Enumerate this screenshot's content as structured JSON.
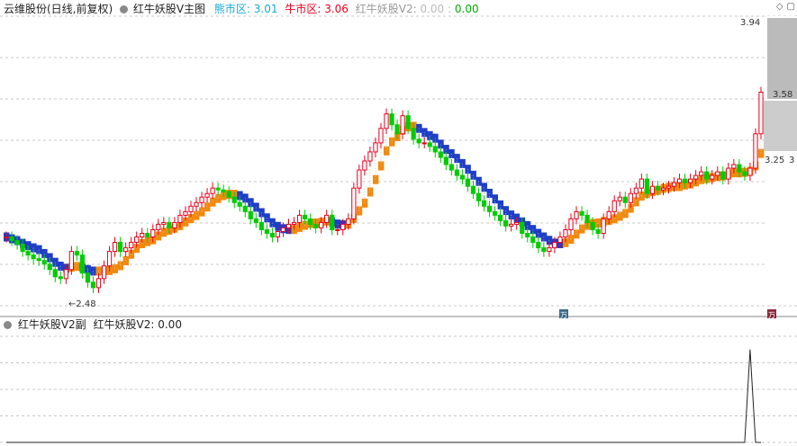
{
  "main_panel": {
    "stock_title": "云维股份(日线,前复权)",
    "indicator_name": "红牛妖股V主图",
    "bear_label": "熊市区:",
    "bear_value": "3.01",
    "bull_label": "牛市区:",
    "bull_value": "3.06",
    "v2_label": "红牛妖股V2:",
    "v2_value_a": "0.00",
    "v2_value_b": "0.00",
    "price_high": "3.94",
    "price_mid": "3.58",
    "price_low_right": "3.25",
    "price_min": "2.48",
    "right_tick_3": "3",
    "badge_blue": "万",
    "badge_red": "万"
  },
  "sub_panel": {
    "indicator_name": "红牛妖股V2副",
    "v2_label": "红牛妖股V2:",
    "v2_value": "0.00"
  },
  "colors": {
    "up": "#e8001c",
    "down": "#00cc00",
    "bear_band": "#1f3ec8",
    "bull_band": "#f08a10",
    "bear_text": "#18a8d8",
    "bull_text": "#e8001c",
    "grid": "#c8c8c8"
  },
  "chart_data": {
    "type": "candlestick",
    "x": [
      1,
      2,
      3,
      4,
      5,
      6,
      7,
      8,
      9,
      10,
      11,
      12,
      13,
      14,
      15,
      16,
      17,
      18,
      19,
      20,
      21,
      22,
      23,
      24,
      25,
      26,
      27,
      28,
      29,
      30,
      31,
      32,
      33,
      34,
      35,
      36,
      37,
      38,
      39,
      40,
      41,
      42,
      43,
      44,
      45,
      46,
      47,
      48,
      49,
      50,
      51,
      52,
      53,
      54,
      55,
      56,
      57,
      58,
      59,
      60,
      61,
      62,
      63,
      64,
      65,
      66,
      67,
      68,
      69,
      70,
      71,
      72,
      73,
      74,
      75,
      76,
      77,
      78,
      79,
      80,
      81,
      82,
      83,
      84,
      85,
      86,
      87,
      88,
      89,
      90,
      91,
      92,
      93,
      94,
      95,
      96,
      97,
      98,
      99,
      100,
      101,
      102,
      103,
      104,
      105,
      106,
      107,
      108,
      109,
      110,
      111,
      112,
      113,
      114,
      115,
      116,
      117,
      118,
      119,
      120,
      121,
      122,
      123,
      124,
      125,
      126,
      127,
      128,
      129,
      130,
      131,
      132,
      133,
      134,
      135,
      136,
      137,
      138,
      139,
      140
    ],
    "close": [
      2.78,
      2.76,
      2.74,
      2.7,
      2.68,
      2.66,
      2.65,
      2.63,
      2.6,
      2.56,
      2.55,
      2.6,
      2.7,
      2.68,
      2.58,
      2.53,
      2.5,
      2.55,
      2.62,
      2.7,
      2.75,
      2.7,
      2.72,
      2.75,
      2.78,
      2.8,
      2.78,
      2.82,
      2.85,
      2.86,
      2.83,
      2.86,
      2.9,
      2.92,
      2.95,
      2.97,
      3.0,
      3.02,
      3.05,
      3.04,
      3.03,
      3.0,
      2.97,
      2.95,
      2.92,
      2.88,
      2.86,
      2.82,
      2.8,
      2.78,
      2.81,
      2.83,
      2.85,
      2.86,
      2.9,
      2.88,
      2.85,
      2.83,
      2.86,
      2.9,
      2.82,
      2.82,
      2.85,
      2.88,
      3.05,
      3.15,
      3.2,
      3.25,
      3.3,
      3.38,
      3.46,
      3.4,
      3.35,
      3.45,
      3.38,
      3.32,
      3.3,
      3.3,
      3.28,
      3.25,
      3.22,
      3.18,
      3.15,
      3.12,
      3.1,
      3.06,
      3.02,
      2.98,
      2.95,
      2.92,
      2.9,
      2.87,
      2.84,
      2.85,
      2.86,
      2.8,
      2.78,
      2.75,
      2.72,
      2.7,
      2.72,
      2.75,
      2.78,
      2.82,
      2.88,
      2.92,
      2.9,
      2.86,
      2.82,
      2.8,
      2.88,
      2.92,
      2.98,
      3.0,
      2.97,
      3.02,
      3.05,
      3.1,
      3.02,
      3.06,
      3.04,
      3.05,
      3.06,
      3.08,
      3.1,
      3.08,
      3.1,
      3.12,
      3.14,
      3.1,
      3.12,
      3.14,
      3.1,
      3.16,
      3.18,
      3.14,
      3.12,
      3.16,
      3.35,
      3.58
    ],
    "support_value": 2.48,
    "marked_prices": [
      3.94,
      3.58,
      3.25,
      2.48
    ],
    "ylim": [
      2.4,
      4.0
    ],
    "sub_series": {
      "name": "红牛妖股V2",
      "values": [
        0,
        0,
        0,
        0,
        0,
        0,
        0,
        0,
        0,
        0,
        0,
        0,
        0,
        0,
        0,
        0,
        0,
        0,
        0,
        0,
        0,
        0,
        0,
        0,
        0,
        0,
        0,
        0,
        0,
        0,
        0,
        0,
        0,
        0,
        0,
        0,
        0,
        0,
        0,
        0,
        0,
        0,
        0,
        0,
        0,
        0,
        0,
        0,
        0,
        0,
        0,
        0,
        0,
        0,
        0,
        0,
        0,
        0,
        0,
        0,
        0,
        0,
        0,
        0,
        0,
        0,
        0,
        0,
        0,
        0,
        0,
        0,
        0,
        0,
        0,
        0,
        0,
        0,
        0,
        0,
        0,
        0,
        0,
        0,
        0,
        0,
        0,
        0,
        0,
        0,
        0,
        0,
        0,
        0,
        0,
        0,
        0,
        0,
        0,
        0,
        0,
        0,
        0,
        0,
        0,
        0,
        0,
        0,
        0,
        0,
        0,
        0,
        0,
        0,
        0,
        0,
        0,
        0,
        0,
        0,
        0,
        0,
        0,
        0,
        0,
        0,
        0,
        0,
        0,
        0,
        0,
        0,
        0,
        0,
        0,
        0,
        0,
        1,
        0,
        0
      ],
      "ylim": [
        0,
        1.2
      ]
    },
    "grid": true
  }
}
